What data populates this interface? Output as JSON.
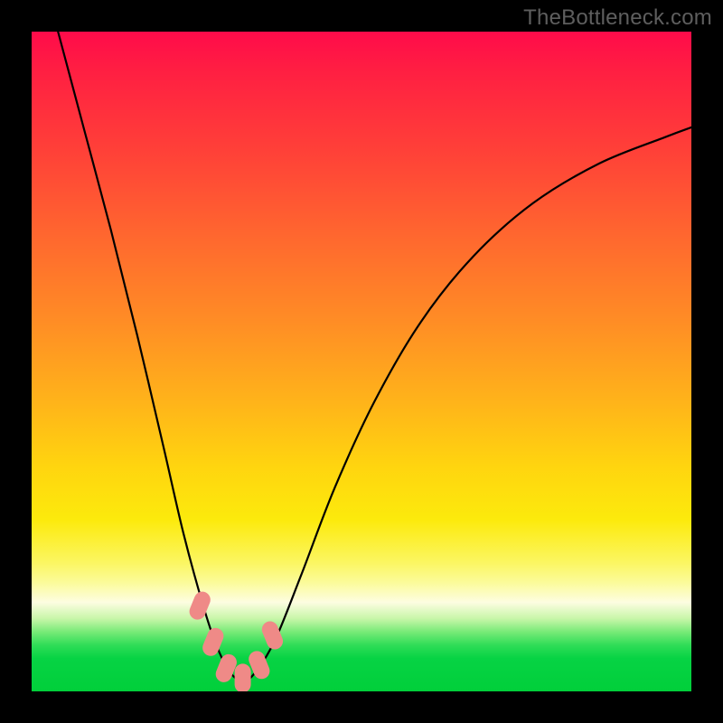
{
  "watermark": "TheBottleneck.com",
  "chart_data": {
    "type": "line",
    "title": "",
    "xlabel": "",
    "ylabel": "",
    "xlim": [
      0,
      1
    ],
    "ylim": [
      0,
      1
    ],
    "grid": false,
    "legend": false,
    "annotations": [],
    "series": [
      {
        "name": "bottleneck-curve",
        "x": [
          0.04,
          0.08,
          0.12,
          0.16,
          0.2,
          0.23,
          0.26,
          0.28,
          0.3,
          0.32,
          0.34,
          0.37,
          0.41,
          0.46,
          0.52,
          0.59,
          0.67,
          0.76,
          0.86,
          0.96,
          1.0
        ],
        "values": [
          1.0,
          0.85,
          0.7,
          0.54,
          0.37,
          0.24,
          0.13,
          0.07,
          0.03,
          0.015,
          0.03,
          0.08,
          0.18,
          0.31,
          0.44,
          0.56,
          0.66,
          0.74,
          0.8,
          0.84,
          0.855
        ]
      }
    ],
    "markers": {
      "name": "highlighted-points",
      "color": "#ef8a87",
      "points": [
        {
          "x": 0.255,
          "y": 0.13
        },
        {
          "x": 0.275,
          "y": 0.075
        },
        {
          "x": 0.295,
          "y": 0.035
        },
        {
          "x": 0.32,
          "y": 0.02
        },
        {
          "x": 0.345,
          "y": 0.04
        },
        {
          "x": 0.365,
          "y": 0.085
        }
      ]
    },
    "background_gradient_stops": [
      {
        "pos": 0.0,
        "color": "#ff0b4a"
      },
      {
        "pos": 0.18,
        "color": "#ff4038"
      },
      {
        "pos": 0.44,
        "color": "#ff8d25"
      },
      {
        "pos": 0.66,
        "color": "#ffd50f"
      },
      {
        "pos": 0.83,
        "color": "#fbfb9a"
      },
      {
        "pos": 0.91,
        "color": "#77ea77"
      },
      {
        "pos": 1.0,
        "color": "#01cf3a"
      }
    ]
  }
}
